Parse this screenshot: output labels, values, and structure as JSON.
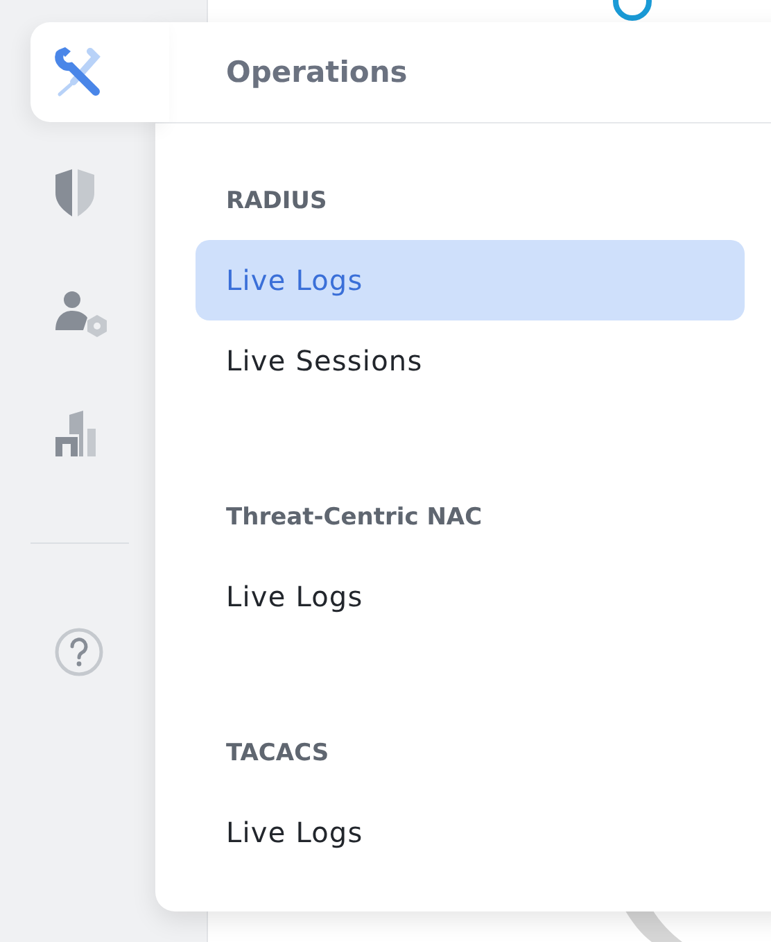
{
  "sidebar": {
    "items": [
      {
        "selected": true
      },
      {
        "selected": false
      },
      {
        "selected": false
      },
      {
        "selected": false
      }
    ]
  },
  "flyout": {
    "title": "Operations",
    "sections": [
      {
        "heading": "RADIUS",
        "items": [
          {
            "label": "Live Logs",
            "selected": true
          },
          {
            "label": "Live Sessions",
            "selected": false
          }
        ]
      },
      {
        "heading": "Threat-Centric NAC",
        "items": [
          {
            "label": "Live Logs",
            "selected": false
          }
        ]
      },
      {
        "heading": "TACACS",
        "items": [
          {
            "label": "Live Logs",
            "selected": false
          }
        ]
      }
    ]
  }
}
